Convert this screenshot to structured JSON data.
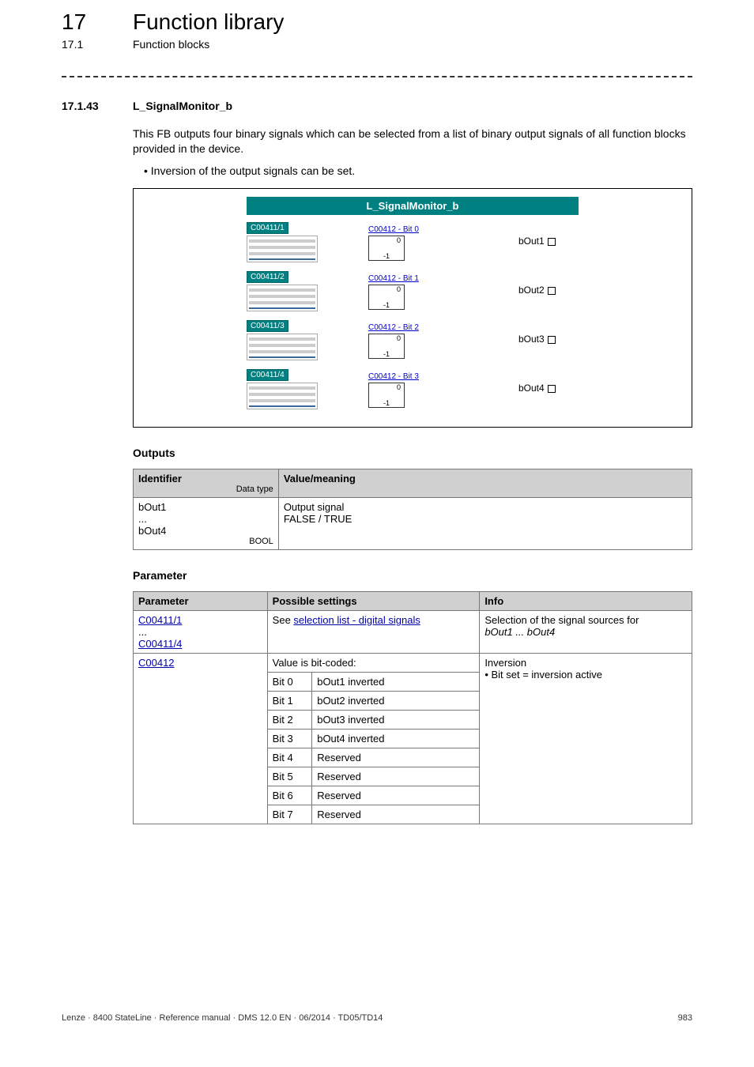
{
  "header": {
    "chapter_no": "17",
    "chapter_title": "Function library",
    "subchapter_no": "17.1",
    "subchapter_title": "Function blocks"
  },
  "section": {
    "no": "17.1.43",
    "title": "L_SignalMonitor_b",
    "paragraph": "This FB outputs four binary signals which can be selected from a list of binary output signals of all function blocks provided in the device.",
    "bullet": "Inversion of the output signals can be set."
  },
  "diagram": {
    "title": "L_SignalMonitor_b",
    "rows": [
      {
        "sel": "C00411/1",
        "bit": "C00412 - Bit 0",
        "out": "bOut1"
      },
      {
        "sel": "C00411/2",
        "bit": "C00412 - Bit 1",
        "out": "bOut2"
      },
      {
        "sel": "C00411/3",
        "bit": "C00412 - Bit 2",
        "out": "bOut3"
      },
      {
        "sel": "C00411/4",
        "bit": "C00412 - Bit 3",
        "out": "bOut4"
      }
    ]
  },
  "outputs": {
    "heading": "Outputs",
    "th_identifier": "Identifier",
    "th_datatype": "Data type",
    "th_value": "Value/meaning",
    "row": {
      "id": "bOut1\n...\nbOut4",
      "dtype": "BOOL",
      "meaning": "Output signal\nFALSE / TRUE"
    }
  },
  "parameter": {
    "heading": "Parameter",
    "th_param": "Parameter",
    "th_settings": "Possible settings",
    "th_info": "Info",
    "row1": {
      "param_top": "C00411/1",
      "param_mid": "...",
      "param_bot": "C00411/4",
      "settings_prefix": "See ",
      "settings_link": "selection list - digital signals",
      "info_l1": "Selection of the signal sources for",
      "info_l2": "bOut1 ... bOut4"
    },
    "row2": {
      "param": "C00412",
      "settings_head": "Value is bit-coded:",
      "bits": [
        {
          "bit": "Bit 0",
          "desc": "bOut1 inverted"
        },
        {
          "bit": "Bit 1",
          "desc": "bOut2 inverted"
        },
        {
          "bit": "Bit 2",
          "desc": "bOut3 inverted"
        },
        {
          "bit": "Bit 3",
          "desc": "bOut4 inverted"
        },
        {
          "bit": "Bit 4",
          "desc": "Reserved"
        },
        {
          "bit": "Bit 5",
          "desc": "Reserved"
        },
        {
          "bit": "Bit 6",
          "desc": "Reserved"
        },
        {
          "bit": "Bit 7",
          "desc": "Reserved"
        }
      ],
      "info_l1": "Inversion",
      "info_l2": "• Bit set = inversion active"
    }
  },
  "footer": {
    "left": "Lenze · 8400 StateLine · Reference manual · DMS 12.0 EN · 06/2014 · TD05/TD14",
    "right": "983"
  }
}
